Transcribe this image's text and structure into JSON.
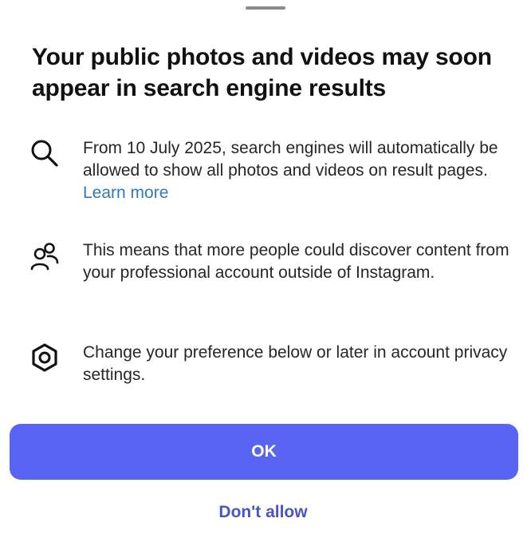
{
  "sheet": {
    "title": "Your public photos and videos may soon appear in search engine results"
  },
  "items": [
    {
      "icon": "search-icon",
      "text": "From 10 July 2025, search engines will automatically be allowed to show all photos and videos on result pages.",
      "link": "Learn more"
    },
    {
      "icon": "people-icon",
      "text": "This means that more people could discover content from your professional account outside of Instagram."
    },
    {
      "icon": "settings-gear-icon",
      "text": "Change your preference below or later in account privacy settings."
    }
  ],
  "actions": {
    "ok_label": "OK",
    "dont_allow_label": "Don't allow"
  },
  "colors": {
    "primary_button": "#5865f2",
    "link": "#2f7bb8",
    "secondary_action": "#4855c4"
  }
}
